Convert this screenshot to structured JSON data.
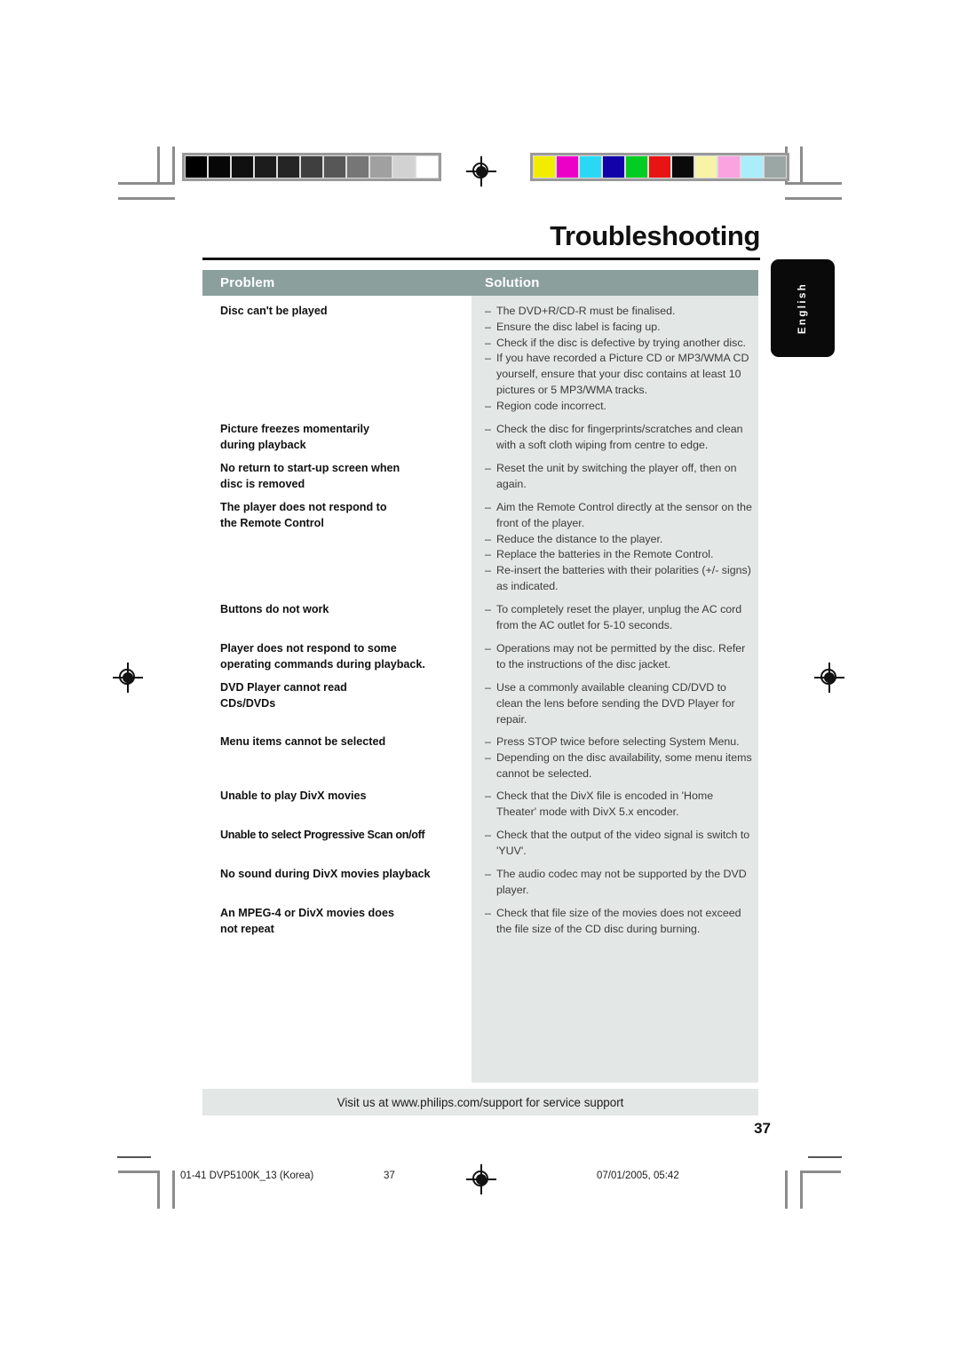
{
  "document": {
    "title": "Troubleshooting",
    "language_tab": "English",
    "page_number": "37"
  },
  "table": {
    "headers": {
      "problem": "Problem",
      "solution": "Solution"
    },
    "rows": [
      {
        "problem": [
          "Disc can't be played"
        ],
        "solutions": [
          "The DVD+R/CD-R must be finalised.",
          "Ensure the disc label is facing up.",
          "Check if the disc is defective by trying another disc.",
          "If you have recorded a Picture CD or MP3/WMA CD yourself, ensure that your disc contains at least 10 pictures or 5 MP3/WMA tracks.",
          "Region code incorrect."
        ]
      },
      {
        "problem": [
          "Picture freezes momentarily",
          "during playback"
        ],
        "solutions": [
          "Check the disc for fingerprints/scratches and clean with a soft cloth wiping from centre to edge."
        ]
      },
      {
        "problem": [
          "No return to start-up screen when",
          "disc is removed"
        ],
        "solutions": [
          "Reset the unit by switching the player off, then on again."
        ]
      },
      {
        "problem": [
          "The player does not respond to",
          "the Remote Control"
        ],
        "solutions": [
          "Aim the Remote Control directly at the sensor on the front of the player.",
          "Reduce the distance to the player.",
          "Replace the batteries in the Remote Control.",
          "Re-insert the batteries with their polarities (+/- signs) as indicated."
        ]
      },
      {
        "problem": [
          "Buttons do not work"
        ],
        "solutions": [
          "To completely reset the player, unplug the AC cord from the AC outlet for 5-10 seconds."
        ]
      },
      {
        "problem": [
          "Player does not respond to some",
          "operating commands during playback."
        ],
        "solutions": [
          "Operations may not be permitted by the disc. Refer to the instructions of  the disc jacket."
        ]
      },
      {
        "problem": [
          "DVD Player cannot read",
          "CDs/DVDs"
        ],
        "solutions": [
          "Use a commonly available cleaning CD/DVD to clean the lens before sending the DVD Player for repair."
        ]
      },
      {
        "problem": [
          "Menu items cannot be selected"
        ],
        "solutions": [
          "Press STOP twice before selecting System Menu.",
          "Depending on the disc availability, some menu items cannot be selected."
        ]
      },
      {
        "problem": [
          "Unable to play DivX movies"
        ],
        "solutions": [
          "Check that the DivX file is encoded in 'Home Theater' mode with DivX 5.x encoder."
        ]
      },
      {
        "problem": [
          "Unable to select Progressive Scan on/off"
        ],
        "solutions": [
          "Check that the output of the video signal is switch to 'YUV'."
        ]
      },
      {
        "problem": [
          "No sound during DivX movies playback"
        ],
        "solutions": [
          "The audio codec may not be supported by the DVD player."
        ]
      },
      {
        "problem": [
          "An MPEG-4 or DivX movies does",
          "not repeat"
        ],
        "solutions": [
          "Check that file size of the movies does not exceed the file size of the CD disc during burning."
        ]
      }
    ]
  },
  "support_banner": {
    "text": "Visit us at www.philips.com/support for service support"
  },
  "print_footer": {
    "file": "01-41 DVP5100K_13 (Korea)",
    "page": "37",
    "date": "07/01/2005, 05:42"
  },
  "calibration": {
    "grayscale_label": "grayscale-swatch-strip",
    "grayscale": [
      "#000000",
      "#070707",
      "#101010",
      "#1c1c1c",
      "#252525",
      "#3f3f3f",
      "#575757",
      "#767676",
      "#a0a0a0",
      "#d2d2d2",
      "#ffffff"
    ],
    "color_label": "color-swatch-strip",
    "colors": [
      "#f2ec00",
      "#ec00c8",
      "#2ad8f5",
      "#1200a8",
      "#00cc22",
      "#e81414",
      "#0a0a0a",
      "#f7f4a8",
      "#fba2e0",
      "#aaeefa",
      "#9aa7a5"
    ]
  },
  "dash": "–"
}
